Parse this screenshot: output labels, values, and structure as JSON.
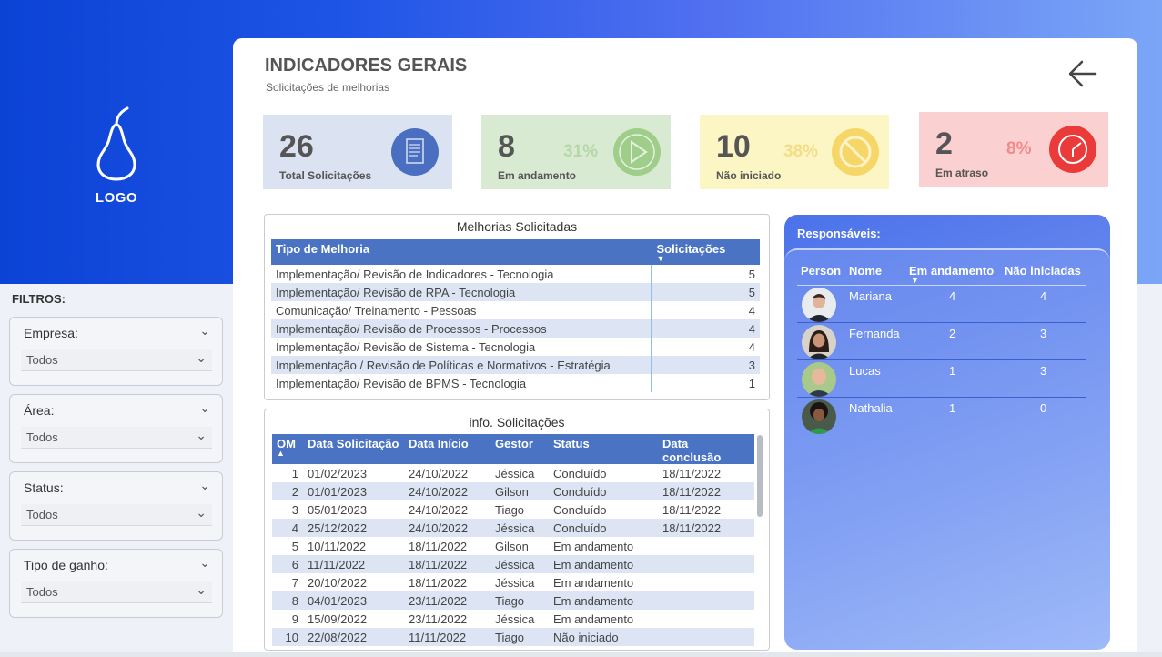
{
  "logo": {
    "text": "LOGO"
  },
  "filters": {
    "title": "FILTROS:",
    "items": [
      {
        "label": "Empresa:",
        "value": "Todos"
      },
      {
        "label": "Área:",
        "value": "Todos"
      },
      {
        "label": "Status:",
        "value": "Todos"
      },
      {
        "label": "Tipo de ganho:",
        "value": "Todos"
      }
    ]
  },
  "header": {
    "title": "INDICADORES GERAIS",
    "subtitle": "Solicitações de melhorias"
  },
  "kpis": [
    {
      "value": "26",
      "label": "Total Solicitações",
      "pct": "",
      "color": "#dbe3f2",
      "icon": "document-icon"
    },
    {
      "value": "8",
      "label": "Em andamento",
      "pct": "31%",
      "color": "#d9ead3",
      "icon": "play-icon"
    },
    {
      "value": "10",
      "label": "Não iniciado",
      "pct": "38%",
      "color": "#fbf6c4",
      "icon": "blocked-icon"
    },
    {
      "value": "2",
      "label": "Em atraso",
      "pct": "8%",
      "color": "#fbd0d0",
      "icon": "clock-icon"
    }
  ],
  "melhorias": {
    "title": "Melhorias Solicitadas",
    "columns": [
      "Tipo de Melhoria",
      "Solicitações"
    ],
    "rows": [
      [
        "Implementação/ Revisão de Indicadores - Tecnologia",
        "5"
      ],
      [
        "Implementação/ Revisão de RPA - Tecnologia",
        "5"
      ],
      [
        "Comunicação/ Treinamento - Pessoas",
        "4"
      ],
      [
        "Implementação/ Revisão de Processos - Processos",
        "4"
      ],
      [
        "Implementação/ Revisão de Sistema - Tecnologia",
        "4"
      ],
      [
        "Implementação / Revisão de Políticas e Normativos - Estratégia",
        "3"
      ],
      [
        "Implementação/ Revisão de BPMS - Tecnologia",
        "1"
      ]
    ]
  },
  "info": {
    "title": "info. Solicitações",
    "columns": [
      "OM",
      "Data Solicitação",
      "Data Início",
      "Gestor",
      "Status",
      "Data conclusão"
    ],
    "rows": [
      [
        "1",
        "01/02/2023",
        "24/10/2022",
        "Jéssica",
        "Concluído",
        "18/11/2022"
      ],
      [
        "2",
        "01/01/2023",
        "24/10/2022",
        "Gilson",
        "Concluído",
        "18/11/2022"
      ],
      [
        "3",
        "05/01/2023",
        "24/10/2022",
        "Tiago",
        "Concluído",
        "18/11/2022"
      ],
      [
        "4",
        "25/12/2022",
        "24/10/2022",
        "Jéssica",
        "Concluído",
        "18/11/2022"
      ],
      [
        "5",
        "10/11/2022",
        "18/11/2022",
        "Gilson",
        "Em andamento",
        ""
      ],
      [
        "6",
        "11/11/2022",
        "18/11/2022",
        "Jéssica",
        "Em andamento",
        ""
      ],
      [
        "7",
        "20/10/2022",
        "18/11/2022",
        "Jéssica",
        "Em andamento",
        ""
      ],
      [
        "8",
        "04/01/2023",
        "23/11/2022",
        "Tiago",
        "Em andamento",
        ""
      ],
      [
        "9",
        "15/09/2022",
        "23/11/2022",
        "Jéssica",
        "Em andamento",
        ""
      ],
      [
        "10",
        "22/08/2022",
        "11/11/2022",
        "Tiago",
        "Não iniciado",
        ""
      ]
    ]
  },
  "responsaveis": {
    "title": "Responsáveis:",
    "columns": [
      "Person",
      "Nome",
      "Em andamento",
      "Não iniciadas"
    ],
    "rows": [
      {
        "name": "Mariana",
        "em_andamento": "4",
        "nao_iniciadas": "4"
      },
      {
        "name": "Fernanda",
        "em_andamento": "2",
        "nao_iniciadas": "3"
      },
      {
        "name": "Lucas",
        "em_andamento": "1",
        "nao_iniciadas": "3"
      },
      {
        "name": "Nathalia",
        "em_andamento": "1",
        "nao_iniciadas": "0"
      }
    ]
  }
}
